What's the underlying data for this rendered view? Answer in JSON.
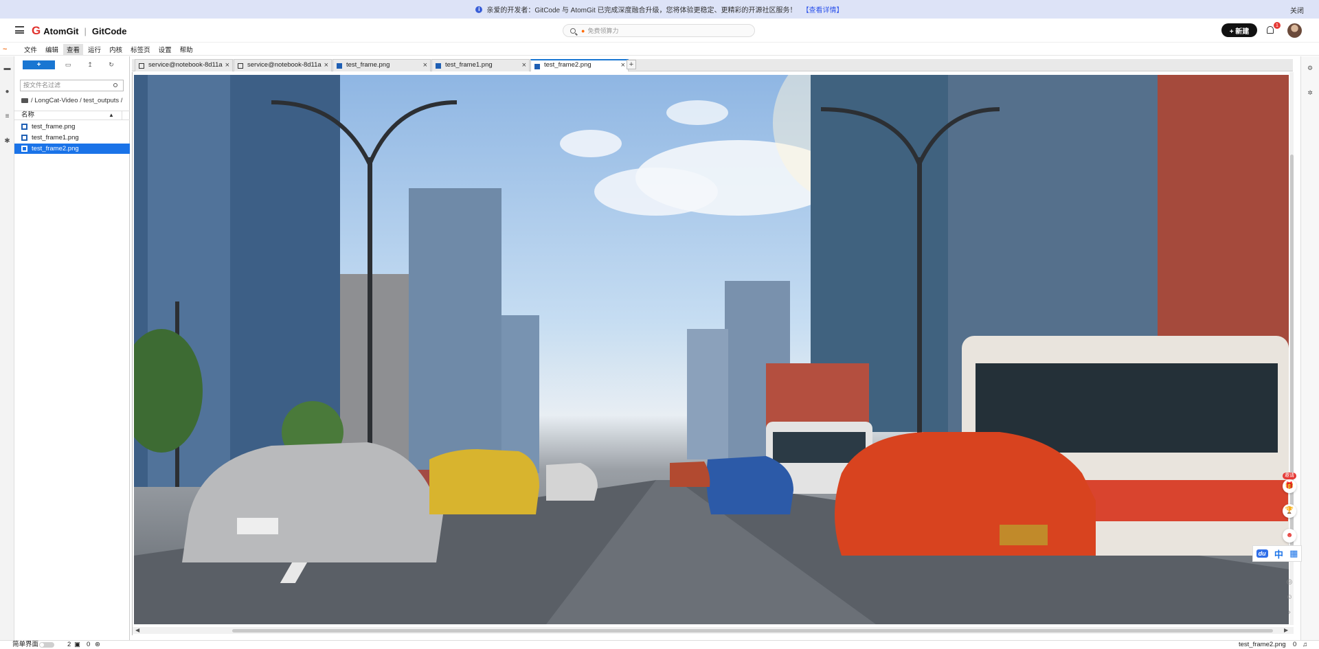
{
  "banner": {
    "message": "亲爱的开发者：GitCode 与 AtomGit 已完成深度融合升级，您将体验更稳定、更精彩的开源社区服务！",
    "link": "【查看详情】",
    "close": "关闭"
  },
  "header": {
    "brand_atomgit": "AtomGit",
    "brand_sep": "|",
    "brand_gitcode": "GitCode",
    "search_placeholder": "免费领算力",
    "new_button": "+ 新建",
    "notification_count": "1"
  },
  "menu": {
    "items": [
      "文件",
      "编辑",
      "查看",
      "运行",
      "内核",
      "标签页",
      "设置",
      "帮助"
    ],
    "active": "查看"
  },
  "filebrowser": {
    "new_button": "+",
    "filter_placeholder": "按文件名过滤",
    "breadcrumb": "/ LongCat-Video / test_outputs /",
    "column_name": "名称",
    "files": [
      {
        "name": "test_frame.png",
        "selected": false
      },
      {
        "name": "test_frame1.png",
        "selected": false
      },
      {
        "name": "test_frame2.png",
        "selected": true
      }
    ]
  },
  "tabs": [
    {
      "label": "service@notebook-8d11a",
      "type": "terminal",
      "active": false
    },
    {
      "label": "service@notebook-8d11a",
      "type": "terminal",
      "active": false
    },
    {
      "label": "test_frame.png",
      "type": "image",
      "active": false
    },
    {
      "label": "test_frame1.png",
      "type": "image",
      "active": false
    },
    {
      "label": "test_frame2.png",
      "type": "image",
      "active": true
    }
  ],
  "tab_add": "+",
  "viewer": {
    "image_description_icon": "city-street-image"
  },
  "floating": {
    "invite_badge": "邀请"
  },
  "ime": {
    "du": "du",
    "lang": "中"
  },
  "statusbar": {
    "simple_mode": "简单界面",
    "count_a": "2",
    "count_b": "0",
    "current_file": "test_frame2.png",
    "right_count": "0"
  },
  "colors": {
    "accent": "#1976d2",
    "brand_red": "#e0302b",
    "banner_bg": "#dde3f7"
  }
}
